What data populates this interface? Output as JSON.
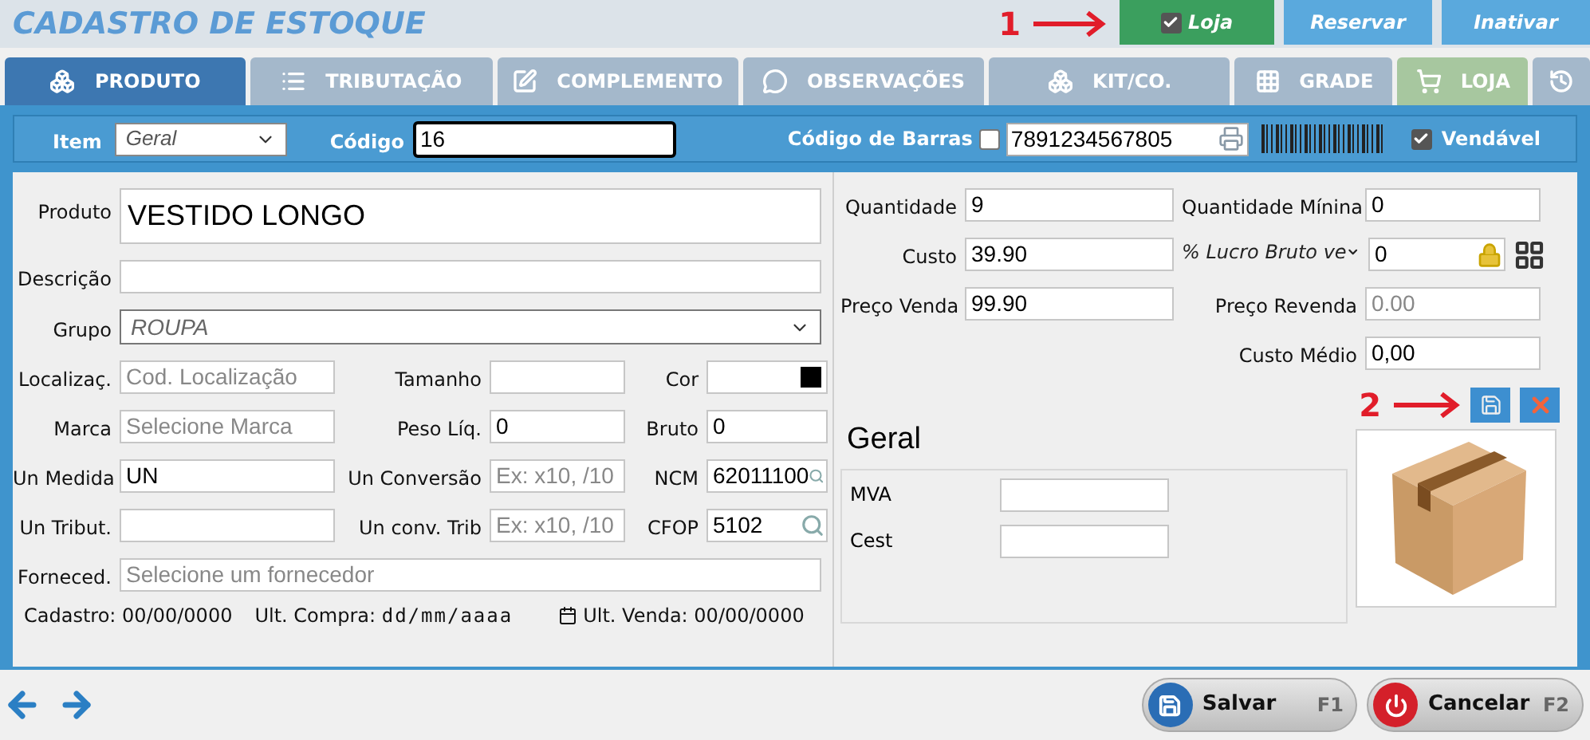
{
  "header": {
    "title": "CADASTRO DE ESTOQUE",
    "annotation": "1",
    "buttons": [
      {
        "label": "Loja",
        "kind": "toggle",
        "checked": true
      },
      {
        "label": "Reservar",
        "kind": "plain"
      },
      {
        "label": "Inativar",
        "kind": "plain"
      }
    ]
  },
  "tabs": [
    {
      "label": "PRODUTO",
      "kind": "section",
      "selected": true
    },
    {
      "label": "TRIBUTAÇÃO",
      "kind": "section",
      "selected": false
    },
    {
      "label": "COMPLEMENTO",
      "kind": "section",
      "selected": false
    },
    {
      "label": "OBSERVAÇÕES",
      "kind": "section",
      "selected": false
    },
    {
      "label": "KIT/CO.",
      "kind": "section",
      "selected": false
    },
    {
      "label": "GRADE",
      "kind": "section",
      "selected": false
    },
    {
      "label": "LOJA",
      "kind": "store",
      "selected": false
    },
    {
      "kind": "history",
      "selected": false
    }
  ],
  "item_bar": {
    "item": {
      "label": "Item",
      "value": "Geral"
    },
    "code": {
      "label": "Código",
      "value": "16"
    },
    "barcode": {
      "label": "Código de Barras",
      "checked": false,
      "value": "7891234567805"
    },
    "sellable": {
      "label": "Vendável",
      "checked": true
    }
  },
  "product_form": {
    "rows": [
      [
        {
          "label": "Produto",
          "value": "VESTIDO LONGO",
          "kind": "large"
        }
      ],
      [
        {
          "label": "Descrição",
          "kind": "text"
        }
      ],
      [
        {
          "label": "Grupo",
          "value": "ROUPA",
          "kind": "select"
        }
      ],
      [
        {
          "label": "Localizaç.",
          "placeholder": "Cod. Localização",
          "kind": "text"
        },
        {
          "label": "Tamanho",
          "kind": "text"
        },
        {
          "label": "Cor",
          "kind": "color",
          "color": "#000000"
        }
      ],
      [
        {
          "label": "Marca",
          "placeholder": "Selecione Marca",
          "kind": "text"
        },
        {
          "label": "Peso Líq.",
          "value": "0",
          "kind": "text"
        },
        {
          "label": "Bruto",
          "value": "0",
          "kind": "text"
        }
      ],
      [
        {
          "label": "Un Medida",
          "value": "UN",
          "kind": "text"
        },
        {
          "label": "Un Conversão",
          "placeholder": "Ex: x10, /10",
          "kind": "text"
        },
        {
          "label": "NCM",
          "value": "62011100",
          "kind": "search"
        }
      ],
      [
        {
          "label": "Un Tribut.",
          "kind": "text"
        },
        {
          "label": "Un conv. Trib",
          "placeholder": "Ex: x10, /10",
          "kind": "text"
        },
        {
          "label": "CFOP",
          "value": "5102",
          "kind": "search"
        }
      ],
      [
        {
          "label": "Forneced.",
          "placeholder": "Selecione um fornecedor",
          "kind": "text"
        }
      ]
    ],
    "meta": [
      {
        "label": "Cadastro:",
        "value": "00/00/0000",
        "kind": "plain"
      },
      {
        "label": "Ult. Compra:",
        "value": "dd/mm/aaaa",
        "kind": "date"
      },
      {
        "label": "Ult. Venda:",
        "value": "00/00/0000",
        "kind": "calendar"
      }
    ]
  },
  "pricing": {
    "rows": [
      [
        {
          "label": "Quantidade",
          "value": "9",
          "kind": "text"
        },
        {
          "label": "Quantidade Mínina",
          "value": "0",
          "kind": "text"
        }
      ],
      [
        {
          "label": "Custo",
          "value": "39.90",
          "kind": "text"
        },
        {
          "label": "% Lucro Bruto ve",
          "value": "0",
          "kind": "margin"
        }
      ],
      [
        {
          "label": "Preço Venda",
          "value": "99.90",
          "kind": "text"
        },
        {
          "label": "Preço Revenda",
          "placeholder": "0.00",
          "kind": "text"
        }
      ],
      [
        null,
        {
          "label": "Custo Médio",
          "value": "0,00",
          "kind": "text"
        }
      ]
    ]
  },
  "tax_group": {
    "title": "Geral",
    "fields": [
      {
        "label": "MVA"
      },
      {
        "label": "Cest"
      }
    ]
  },
  "image": {
    "annotation": "2"
  },
  "footer": {
    "buttons": [
      {
        "label": "Salvar",
        "shortcut": "F1",
        "kind": "save"
      },
      {
        "label": "Cancelar",
        "shortcut": "F2",
        "kind": "cancel"
      }
    ]
  }
}
